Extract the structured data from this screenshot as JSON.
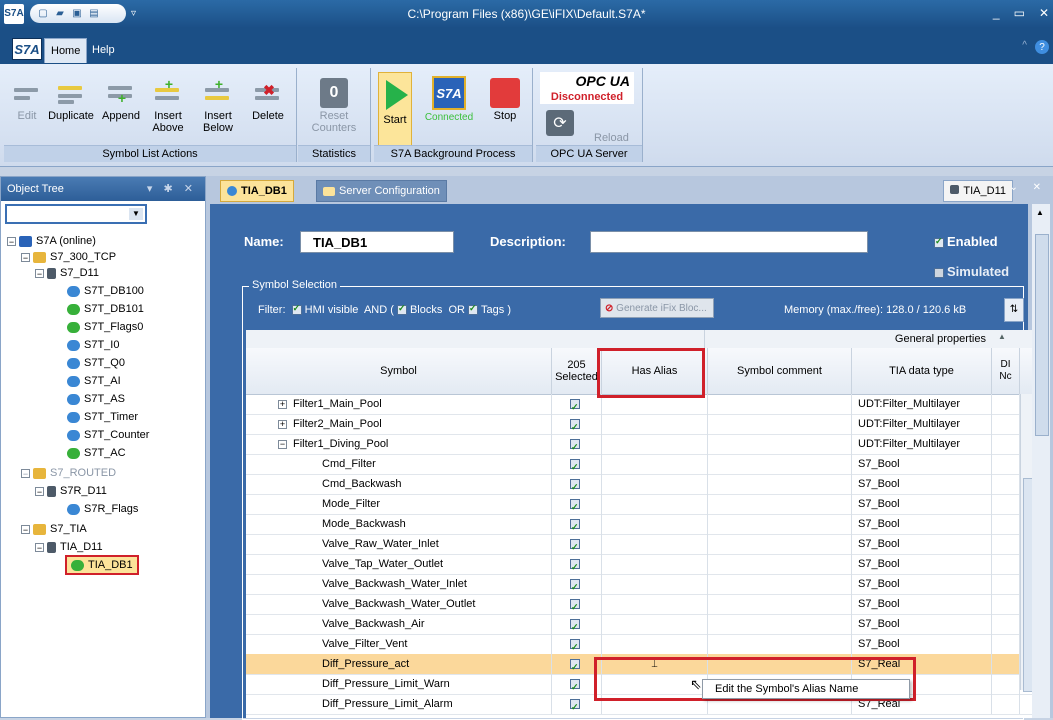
{
  "window": {
    "title": "C:\\Program Files (x86)\\GE\\iFIX\\Default.S7A*",
    "app_icon": "S7A",
    "min": "_",
    "max": "▭",
    "close": "✕"
  },
  "ribbon_tabs": {
    "home": "Home",
    "help": "Help",
    "logo": "S7A"
  },
  "ribbon": {
    "edit": "Edit",
    "duplicate": "Duplicate",
    "append": "Append",
    "insert_above_1": "Insert",
    "insert_above_2": "Above",
    "insert_below_1": "Insert",
    "insert_below_2": "Below",
    "delete": "Delete",
    "group_symbol": "Symbol List Actions",
    "counter_value": "0",
    "reset_1": "Reset",
    "reset_2": "Counters",
    "group_statistics": "Statistics",
    "start": "Start",
    "connected": "Connected",
    "stop": "Stop",
    "group_bg": "S7A Background Process",
    "opc_logo": "OPC UA",
    "opc_status": "Disconnected",
    "reload": "Reload",
    "group_opc": "OPC UA Server"
  },
  "object_tree": {
    "header": "Object Tree",
    "nodes": {
      "root": "S7A (online)",
      "tcp": "S7_300_TCP",
      "d11": "S7_D11",
      "db100": "S7T_DB100",
      "db101": "S7T_DB101",
      "flags0": "S7T_Flags0",
      "i0": "S7T_I0",
      "q0": "S7T_Q0",
      "ai": "S7T_AI",
      "as": "S7T_AS",
      "timer": "S7T_Timer",
      "counter": "S7T_Counter",
      "ac": "S7T_AC",
      "routed": "S7_ROUTED",
      "r_d11": "S7R_D11",
      "r_flags": "S7R_Flags",
      "tia": "S7_TIA",
      "tia_d11": "TIA_D11",
      "tia_db1": "TIA_DB1"
    }
  },
  "doc_tabs": {
    "tia_db1": "TIA_DB1",
    "server_config": "Server Configuration",
    "right": "TIA_D11"
  },
  "form": {
    "name_label": "Name:",
    "name_value": "TIA_DB1",
    "desc_label": "Description:",
    "desc_value": "",
    "enabled": "Enabled",
    "simulated": "Simulated"
  },
  "symbol_selection": {
    "legend": "Symbol Selection",
    "filter_label": "Filter:",
    "hmi": "HMI visible",
    "and": "AND (",
    "blocks": "Blocks",
    "or": "OR",
    "tags": "Tags )",
    "generate": "Generate iFix Bloc...",
    "memory": "Memory (max./free): 128.0 / 120.6 kB",
    "sort": "⇅"
  },
  "grid": {
    "group_header": "General properties",
    "headers": {
      "symbol": "Symbol",
      "selected_count": "205",
      "selected": "Selected",
      "alias": "Has Alias",
      "comment": "Symbol comment",
      "tia_type": "TIA data type",
      "extra_1": "DI",
      "extra_2": "Nc"
    },
    "rows": [
      {
        "symbol": "Filter1_Main_Pool",
        "type": "UDT:Filter_Multilayer",
        "exp": "⊞",
        "indent": 1
      },
      {
        "symbol": "Filter2_Main_Pool",
        "type": "UDT:Filter_Multilayer",
        "exp": "⊞",
        "indent": 1
      },
      {
        "symbol": "Filter1_Diving_Pool",
        "type": "UDT:Filter_Multilayer",
        "exp": "⊟",
        "indent": 1
      },
      {
        "symbol": "Cmd_Filter",
        "type": "S7_Bool",
        "indent": 2
      },
      {
        "symbol": "Cmd_Backwash",
        "type": "S7_Bool",
        "indent": 2
      },
      {
        "symbol": "Mode_Filter",
        "type": "S7_Bool",
        "indent": 2
      },
      {
        "symbol": "Mode_Backwash",
        "type": "S7_Bool",
        "indent": 2
      },
      {
        "symbol": "Valve_Raw_Water_Inlet",
        "type": "S7_Bool",
        "indent": 2
      },
      {
        "symbol": "Valve_Tap_Water_Outlet",
        "type": "S7_Bool",
        "indent": 2
      },
      {
        "symbol": "Valve_Backwash_Water_Inlet",
        "type": "S7_Bool",
        "indent": 2
      },
      {
        "symbol": "Valve_Backwash_Water_Outlet",
        "type": "S7_Bool",
        "indent": 2
      },
      {
        "symbol": "Valve_Backwash_Air",
        "type": "S7_Bool",
        "indent": 2
      },
      {
        "symbol": "Valve_Filter_Vent",
        "type": "S7_Bool",
        "indent": 2
      },
      {
        "symbol": "Diff_Pressure_act",
        "type": "S7_Real",
        "indent": 2,
        "highlight": true
      },
      {
        "symbol": "Diff_Pressure_Limit_Warn",
        "type": "",
        "indent": 2
      },
      {
        "symbol": "Diff_Pressure_Limit_Alarm",
        "type": "S7_Real",
        "indent": 2
      }
    ]
  },
  "context_menu": {
    "item": "Edit the Symbol's Alias Name"
  },
  "colors": {
    "accent": "#1b4f86",
    "highlight": "#fbd89b",
    "annotation": "#d0202a"
  }
}
